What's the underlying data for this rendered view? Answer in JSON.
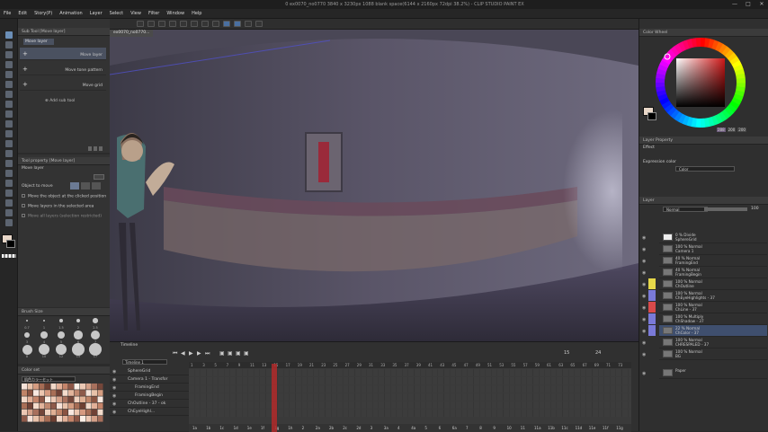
{
  "window": {
    "title": "0 ex0070_no0770 3840 x 3230px 1088 blank space(6144 x 2160px 72dpi 38.2%) - CLIP STUDIO PAINT EX",
    "min_glyph": "—",
    "max_glyph": "□",
    "close_glyph": "✕"
  },
  "menu": [
    "File",
    "Edit",
    "Story(P)",
    "Animation",
    "Layer",
    "Select",
    "View",
    "Filter",
    "Window",
    "Help"
  ],
  "sub_tool": {
    "header": "Sub Tool [Move layer]",
    "tab_label": "Move layer",
    "items": [
      {
        "label": "Move layer",
        "icon": "+"
      },
      {
        "label": "Move tone pattern",
        "icon": "+"
      },
      {
        "label": "Move grid",
        "icon": "+"
      }
    ],
    "add_label": "Add sub tool"
  },
  "tool_property": {
    "header": "Tool property [Move layer]",
    "tool_name": "Move layer",
    "object_label": "Object to move",
    "options": [
      "Move the object at the clicked position",
      "Move layers in the selected area",
      "Move all layers (selection restricted)"
    ]
  },
  "brush_size": {
    "header": "Brush Size",
    "sizes": [
      "0.7",
      "1",
      "1.5",
      "2",
      "2.5",
      "3",
      "4",
      "5",
      "6",
      "7",
      "8",
      "10",
      "12",
      "15",
      "17"
    ]
  },
  "color_set": {
    "header": "Color set",
    "set_name": "肌色カラーセット"
  },
  "canvas": {
    "tab_label": "ex0070_no0770..."
  },
  "timeline": {
    "header": "Timeline",
    "timeline_name": "Timeline 1",
    "frame_readout": "15",
    "total_frames": "24",
    "frame_numbers": [
      "1",
      "3",
      "5",
      "7",
      "9",
      "11",
      "13",
      "15",
      "17",
      "19",
      "21",
      "23",
      "25",
      "27",
      "29",
      "31",
      "33",
      "35",
      "37",
      "39",
      "41",
      "43",
      "45",
      "47",
      "49",
      "51",
      "53",
      "55",
      "57",
      "59",
      "61",
      "63",
      "65",
      "67",
      "69",
      "71",
      "73"
    ],
    "tracks": [
      {
        "name": "SphereGrid"
      },
      {
        "name": "Camera 1 - Transfor"
      },
      {
        "name": "FramingEnd"
      },
      {
        "name": "FramingBegin"
      },
      {
        "name": "ChOutline - 37 - ok"
      },
      {
        "name": "ChEyeHighl..."
      }
    ],
    "cel_labels": [
      "1a",
      "1b",
      "1c",
      "1d",
      "1e",
      "1f",
      "1g",
      "1h",
      "2",
      "2a",
      "2b",
      "2c",
      "2d",
      "3",
      "3a",
      "4",
      "4a",
      "5",
      "6",
      "6a",
      "7",
      "8",
      "9",
      "10",
      "11",
      "11a",
      "11b",
      "11c",
      "11d",
      "11e",
      "11f",
      "11g"
    ]
  },
  "color_wheel": {
    "header": "Color Wheel",
    "hsv": [
      "288",
      "200",
      "200"
    ],
    "main_color": "#e8d7c8"
  },
  "layer_property": {
    "header": "Layer Property",
    "effect_label": "Effect",
    "expression_label": "Expression color",
    "expression_value": "Color"
  },
  "layer_panel": {
    "header": "Layer",
    "blend_mode": "Normal",
    "opacity": "100",
    "layers": [
      {
        "line1": "0 % Divide",
        "line2": "SphereGrid",
        "flag": ""
      },
      {
        "line1": "100 % Normal",
        "line2": "Camera 1",
        "flag": ""
      },
      {
        "line1": "40 % Normal",
        "line2": "FramingEnd",
        "flag": ""
      },
      {
        "line1": "40 % Normal",
        "line2": "FramingBegin",
        "flag": ""
      },
      {
        "line1": "100 % Normal",
        "line2": "ChOutline",
        "flag": "#e6d84a"
      },
      {
        "line1": "100 % Normal",
        "line2": "ChEyeHighlights - 37",
        "flag": "#7a7ad8"
      },
      {
        "line1": "100 % Normal",
        "line2": "ChLine - 37",
        "flag": "#d84a4a"
      },
      {
        "line1": "100 % Multiply",
        "line2": "ChShadow - 37",
        "flag": "#7a7ad8"
      },
      {
        "line1": "22 % Normal",
        "line2": "ChColor - 37",
        "flag": "#7a7ad8"
      },
      {
        "line1": "100 % Normal",
        "line2": "CHRESPALED - 37",
        "flag": ""
      },
      {
        "line1": "100 % Normal",
        "line2": "BG",
        "flag": ""
      },
      {
        "line1": "",
        "line2": "Paper",
        "flag": ""
      }
    ]
  }
}
